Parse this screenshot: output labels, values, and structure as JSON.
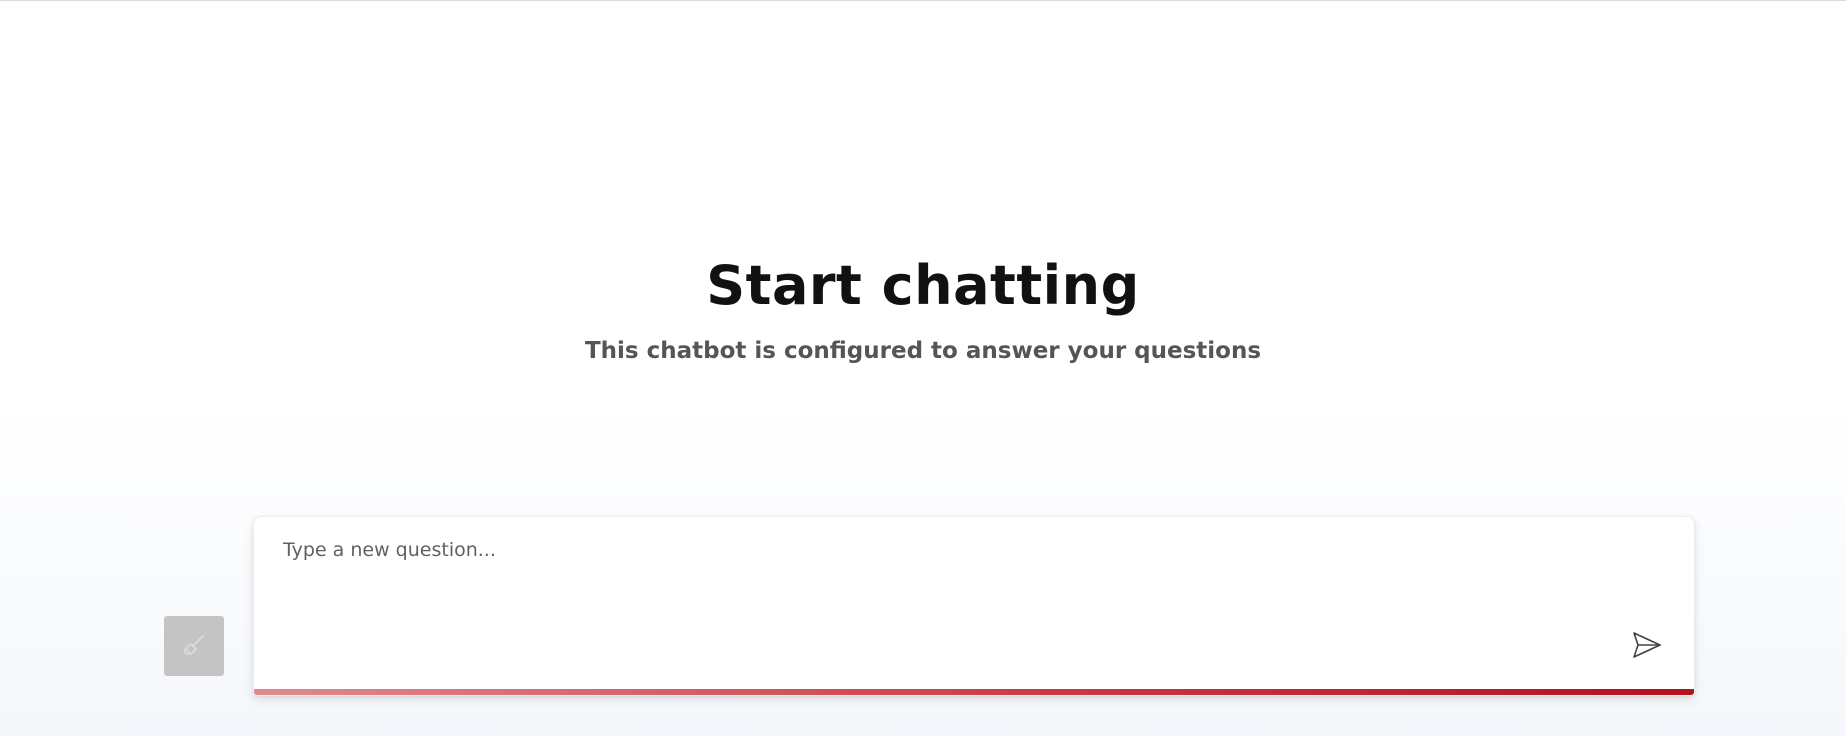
{
  "empty_state": {
    "title": "Start chatting",
    "subtitle": "This chatbot is configured to answer your questions"
  },
  "clear_button": {
    "icon": "broom-icon",
    "aria_label": "Clear chat"
  },
  "question_input": {
    "placeholder": "Type a new question...",
    "value": ""
  },
  "send_button": {
    "icon": "send-icon",
    "aria_label": "Ask question button"
  },
  "colors": {
    "accent_start": "#e08a8f",
    "accent_end": "#b3111c",
    "clear_button_bg": "#c4c4c4",
    "title": "#111111",
    "subtitle": "#555555"
  }
}
